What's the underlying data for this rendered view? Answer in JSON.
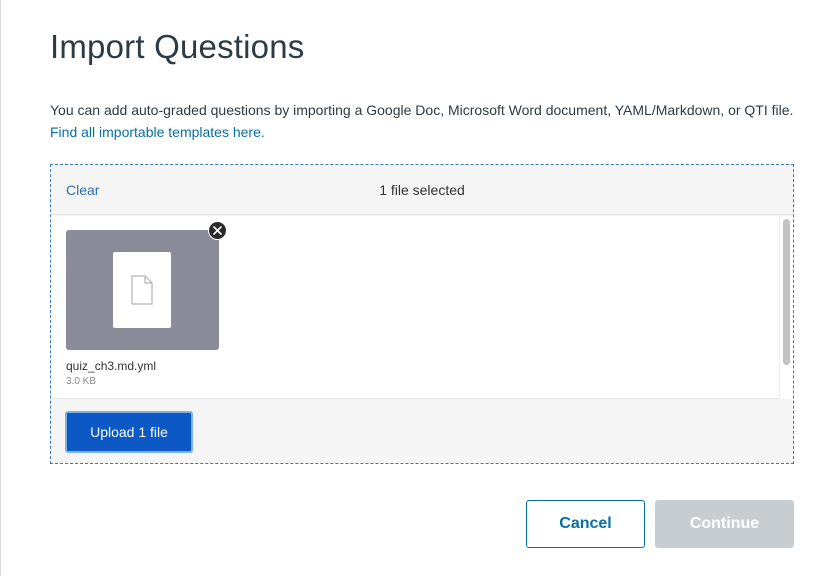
{
  "dialog": {
    "title": "Import Questions",
    "description": "You can add auto-graded questions by importing a Google Doc, Microsoft Word document, YAML/Markdown, or QTI file.",
    "templates_link": "Find all importable templates here."
  },
  "dropzone": {
    "clear_label": "Clear",
    "status": "1 file selected",
    "files": [
      {
        "name": "quiz_ch3.md.yml",
        "size": "3.0 KB",
        "icon": "file-icon"
      }
    ],
    "upload_label": "Upload 1 file"
  },
  "footer": {
    "cancel_label": "Cancel",
    "continue_label": "Continue"
  },
  "colors": {
    "link": "#0770a3",
    "primary_button": "#0c58c4",
    "disabled_button": "#c7cdd1",
    "dropzone_border": "#3a7bbf"
  }
}
